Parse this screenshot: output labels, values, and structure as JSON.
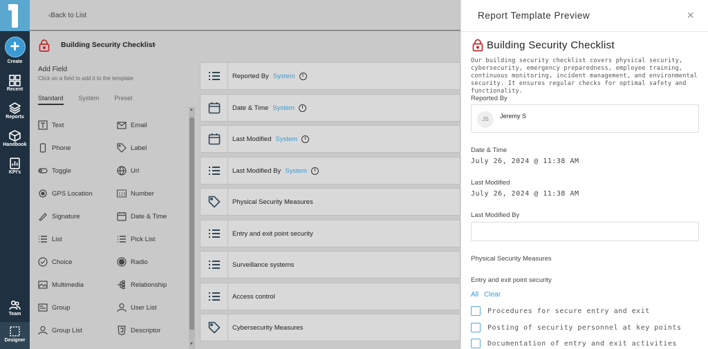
{
  "nav": {
    "create": "Create",
    "items": [
      "Recent",
      "Reports",
      "Handbook",
      "KPI's"
    ],
    "team": "Team",
    "designer": "Designer"
  },
  "topbar": {
    "back": "Back to List"
  },
  "template": {
    "name": "Building Security Checklist"
  },
  "fields_panel": {
    "title": "Add Field",
    "subtitle": "Click on a field to add it to the template",
    "tabs": [
      "Standard",
      "System",
      "Preset"
    ],
    "items": [
      "Text",
      "Email",
      "Phone",
      "Label",
      "Toggle",
      "Url",
      "GPS Location",
      "Number",
      "Signature",
      "Date & Time",
      "List",
      "Pick List",
      "Choice",
      "Radio",
      "Multimedia",
      "Relationship",
      "Group",
      "User List",
      "Group List",
      "Descriptor"
    ]
  },
  "canvas": {
    "rows": [
      {
        "label": "Reported By",
        "tag": "System",
        "icon": "list-icon"
      },
      {
        "label": "Date & Time",
        "tag": "System",
        "icon": "calendar-icon"
      },
      {
        "label": "Last Modified",
        "tag": "System",
        "icon": "calendar-icon"
      },
      {
        "label": "Last Modified By",
        "tag": "System",
        "icon": "list-icon"
      },
      {
        "label": "Physical Security Measures",
        "tag": "",
        "icon": "tag-icon"
      },
      {
        "label": "Entry and exit point security",
        "tag": "",
        "icon": "list-icon"
      },
      {
        "label": "Surveillance systems",
        "tag": "",
        "icon": "list-icon"
      },
      {
        "label": "Access control",
        "tag": "",
        "icon": "list-icon"
      },
      {
        "label": "Cybersecurity Measures",
        "tag": "",
        "icon": "tag-icon"
      }
    ]
  },
  "preview": {
    "title": "Report Template Preview",
    "name": "Building Security Checklist",
    "description": "Our building security checklist covers physical security, cybersecurity, emergency preparedness, employee training, continuous monitoring, incident management, and environmental security. It ensures regular checks for optimal safety and functionality.",
    "reported_by_label": "Reported By",
    "user_initials": "JS",
    "user_name": "Jeremy S",
    "date_time_label": "Date & Time",
    "date_time_value": "July 26, 2024 @ 11:38 AM",
    "last_modified_label": "Last Modified",
    "last_modified_value": "July 26, 2024 @ 11:38 AM",
    "last_modified_by_label": "Last Modified By",
    "physical_label": "Physical Security Measures",
    "entry_label": "Entry and exit point security",
    "all": "All",
    "clear": "Clear",
    "checks": [
      "Procedures for secure entry and exit",
      "Posting of security personnel at key points",
      "Documentation of entry and exit activities"
    ]
  },
  "colors": {
    "accent": "#3a9ad1",
    "rail": "#1f3140",
    "lock": "#c0282d"
  }
}
